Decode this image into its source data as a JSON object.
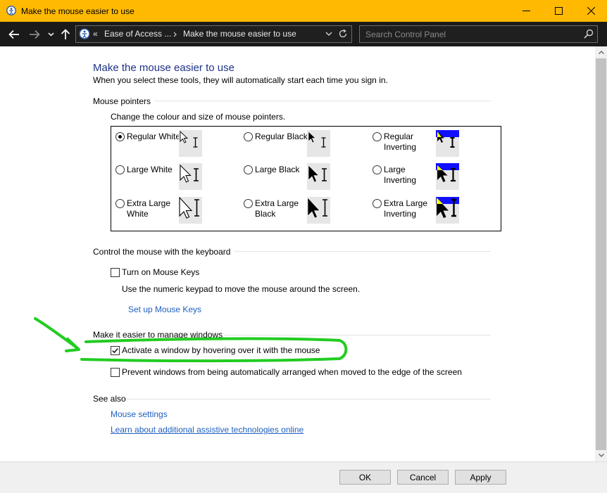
{
  "window": {
    "title": "Make the mouse easier to use",
    "accent": "#ffb900"
  },
  "nav": {
    "back_icon": "back-arrow-icon",
    "forward_icon": "forward-arrow-icon",
    "recent_icon": "chevron-down-icon",
    "up_icon": "up-arrow-icon",
    "breadcrumb_prefix": "«",
    "breadcrumb": [
      "Ease of Access ...",
      "Make the mouse easier to use"
    ],
    "search_placeholder": "Search Control Panel"
  },
  "main": {
    "title": "Make the mouse easier to use",
    "subtitle": "When you select these tools, they will automatically start each time you sign in.",
    "pointers": {
      "heading": "Mouse pointers",
      "instruction": "Change the colour and size of mouse pointers.",
      "options": [
        {
          "label": "Regular White",
          "selected": true
        },
        {
          "label": "Regular Black",
          "selected": false
        },
        {
          "label": "Regular Inverting",
          "selected": false
        },
        {
          "label": "Large White",
          "selected": false
        },
        {
          "label": "Large Black",
          "selected": false
        },
        {
          "label": "Large Inverting",
          "selected": false
        },
        {
          "label": "Extra Large White",
          "selected": false
        },
        {
          "label": "Extra Large Black",
          "selected": false
        },
        {
          "label": "Extra Large Inverting",
          "selected": false
        }
      ]
    },
    "keyboard": {
      "heading": "Control the mouse with the keyboard",
      "mouse_keys_label": "Turn on Mouse Keys",
      "mouse_keys_checked": false,
      "mouse_keys_desc": "Use the numeric keypad to move the mouse around the screen.",
      "setup_link": "Set up Mouse Keys"
    },
    "windows": {
      "heading": "Make it easier to manage windows",
      "hover_label": "Activate a window by hovering over it with the mouse",
      "hover_checked": true,
      "snap_label": "Prevent windows from being automatically arranged when moved to the edge of the screen",
      "snap_checked": false
    },
    "see_also": {
      "heading": "See also",
      "links": [
        "Mouse settings",
        "Learn about additional assistive technologies online"
      ]
    }
  },
  "footer": {
    "ok": "OK",
    "cancel": "Cancel",
    "apply": "Apply"
  },
  "colors": {
    "link": "#1f5fbf",
    "title": "#1e3287",
    "annotation": "#22cc22",
    "invert_blue": "#1010ff",
    "invert_yellow": "#ffff00"
  }
}
